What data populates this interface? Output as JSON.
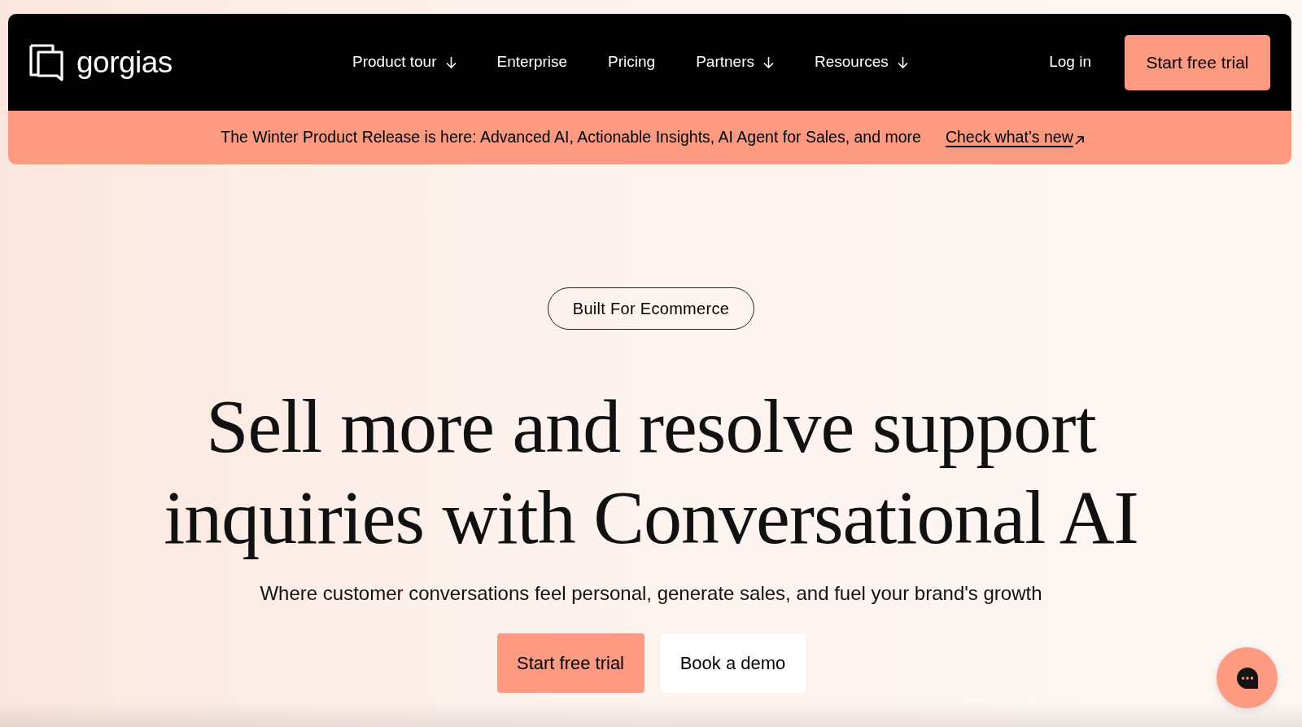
{
  "nav": {
    "logo": "gorgias",
    "menu": [
      {
        "label": "Product tour",
        "kind": "dropdown"
      },
      {
        "label": "Enterprise",
        "kind": "link"
      },
      {
        "label": "Pricing",
        "kind": "link"
      },
      {
        "label": "Partners",
        "kind": "dropdown"
      },
      {
        "label": "Resources",
        "kind": "dropdown"
      }
    ],
    "login": "Log in",
    "cta": "Start free trial"
  },
  "announcement": {
    "text": "The Winter Product Release is here: Advanced AI, Actionable Insights, AI Agent for Sales, and more",
    "link": "Check what’s new"
  },
  "hero": {
    "badge": "Built For Ecommerce",
    "headline": "Sell more and resolve support inquiries with Conversational AI",
    "subtitle": "Where customer conversations feel personal, generate sales, and fuel your brand's growth",
    "buttons": [
      {
        "label": "Start free trial",
        "kind": "primary"
      },
      {
        "label": "Book a demo",
        "kind": "secondary"
      }
    ]
  }
}
